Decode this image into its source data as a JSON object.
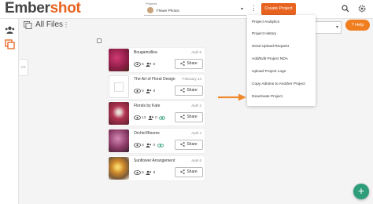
{
  "app": {
    "logo_main": "Ember",
    "logo_accent": "shot"
  },
  "header": {
    "project_label": "Projects",
    "project_value": "Flower Photos",
    "create_label": "Create Project",
    "kebab_glyph": "⋮"
  },
  "page": {
    "title": "All Files",
    "kebab_glyph": "⋮",
    "help_label": "? Help",
    "fab_glyph": "+"
  },
  "cards": [
    {
      "name": "Bougainvillea",
      "date": "April 6",
      "views": "5",
      "people": "8",
      "share": "Share",
      "thumb_color": "#b0265a"
    },
    {
      "name": "The Art of Floral Design",
      "date": "February 14",
      "views": "5",
      "people": "8",
      "share": "Share",
      "thumb_color": ""
    },
    {
      "name": "Florals by Kate",
      "date": "April 4",
      "views": "13",
      "people": "0",
      "share": "Share",
      "thumb_color": "#a8324a"
    },
    {
      "name": "Orchid Blooms",
      "date": "April 4",
      "views": "5",
      "people": "0",
      "share": "Share",
      "thumb_color": "#8a3a66"
    },
    {
      "name": "Sunflower Arrangement",
      "date": "April 6",
      "views": "5",
      "people": "8",
      "share": "Share",
      "thumb_color": "#c98a2a"
    }
  ],
  "menu": [
    "Project Analytics",
    "Project History",
    "Send Upload Request",
    "Add/Edit Project NDA",
    "Upload Project Logo",
    "Copy Admins to Another Project",
    "Deactivate Project"
  ],
  "colors": {
    "accent": "#e8631f",
    "fab": "#2e9e7a",
    "arrow": "#f0892e"
  }
}
